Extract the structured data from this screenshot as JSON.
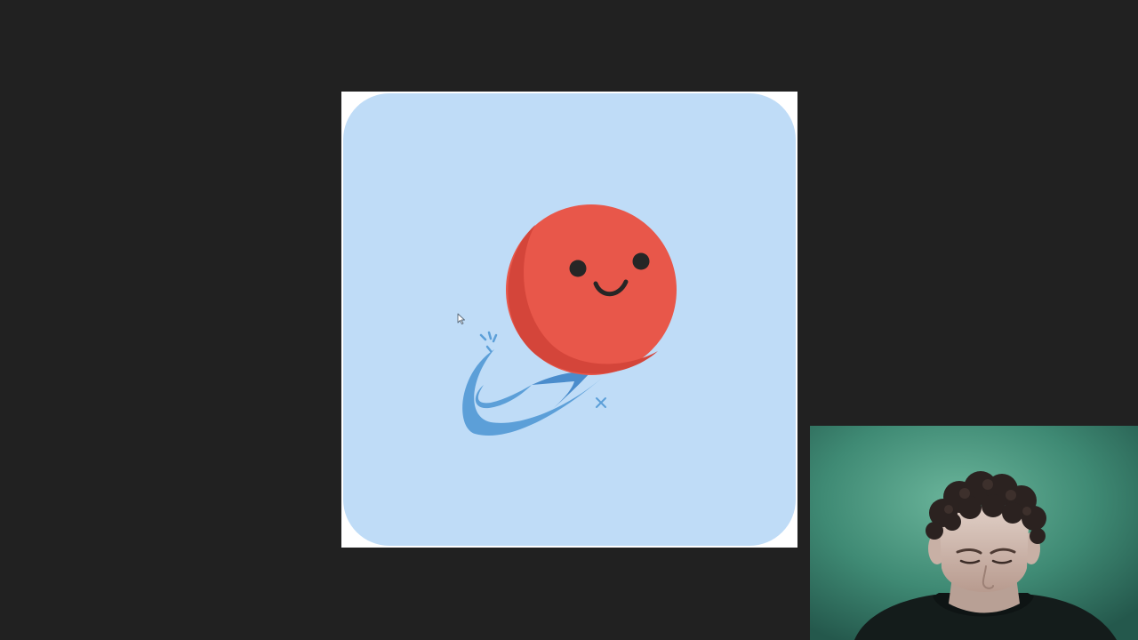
{
  "screen": {
    "background_color": "#212121"
  },
  "app_icon": {
    "icon": "smiling-ball-icon",
    "tile_color": "#bfdcf7",
    "frame_color": "#ffffff",
    "ball_color": "#e8574a",
    "ball_shade_color": "#d4453a",
    "face_color": "#262626",
    "swoosh_color": "#5c9fd8",
    "swoosh_dark_color": "#4a8ccc"
  },
  "pointer": {
    "icon": "mouse-cursor-icon"
  },
  "webcam_overlay": {
    "background_color": "#3f8a74"
  }
}
